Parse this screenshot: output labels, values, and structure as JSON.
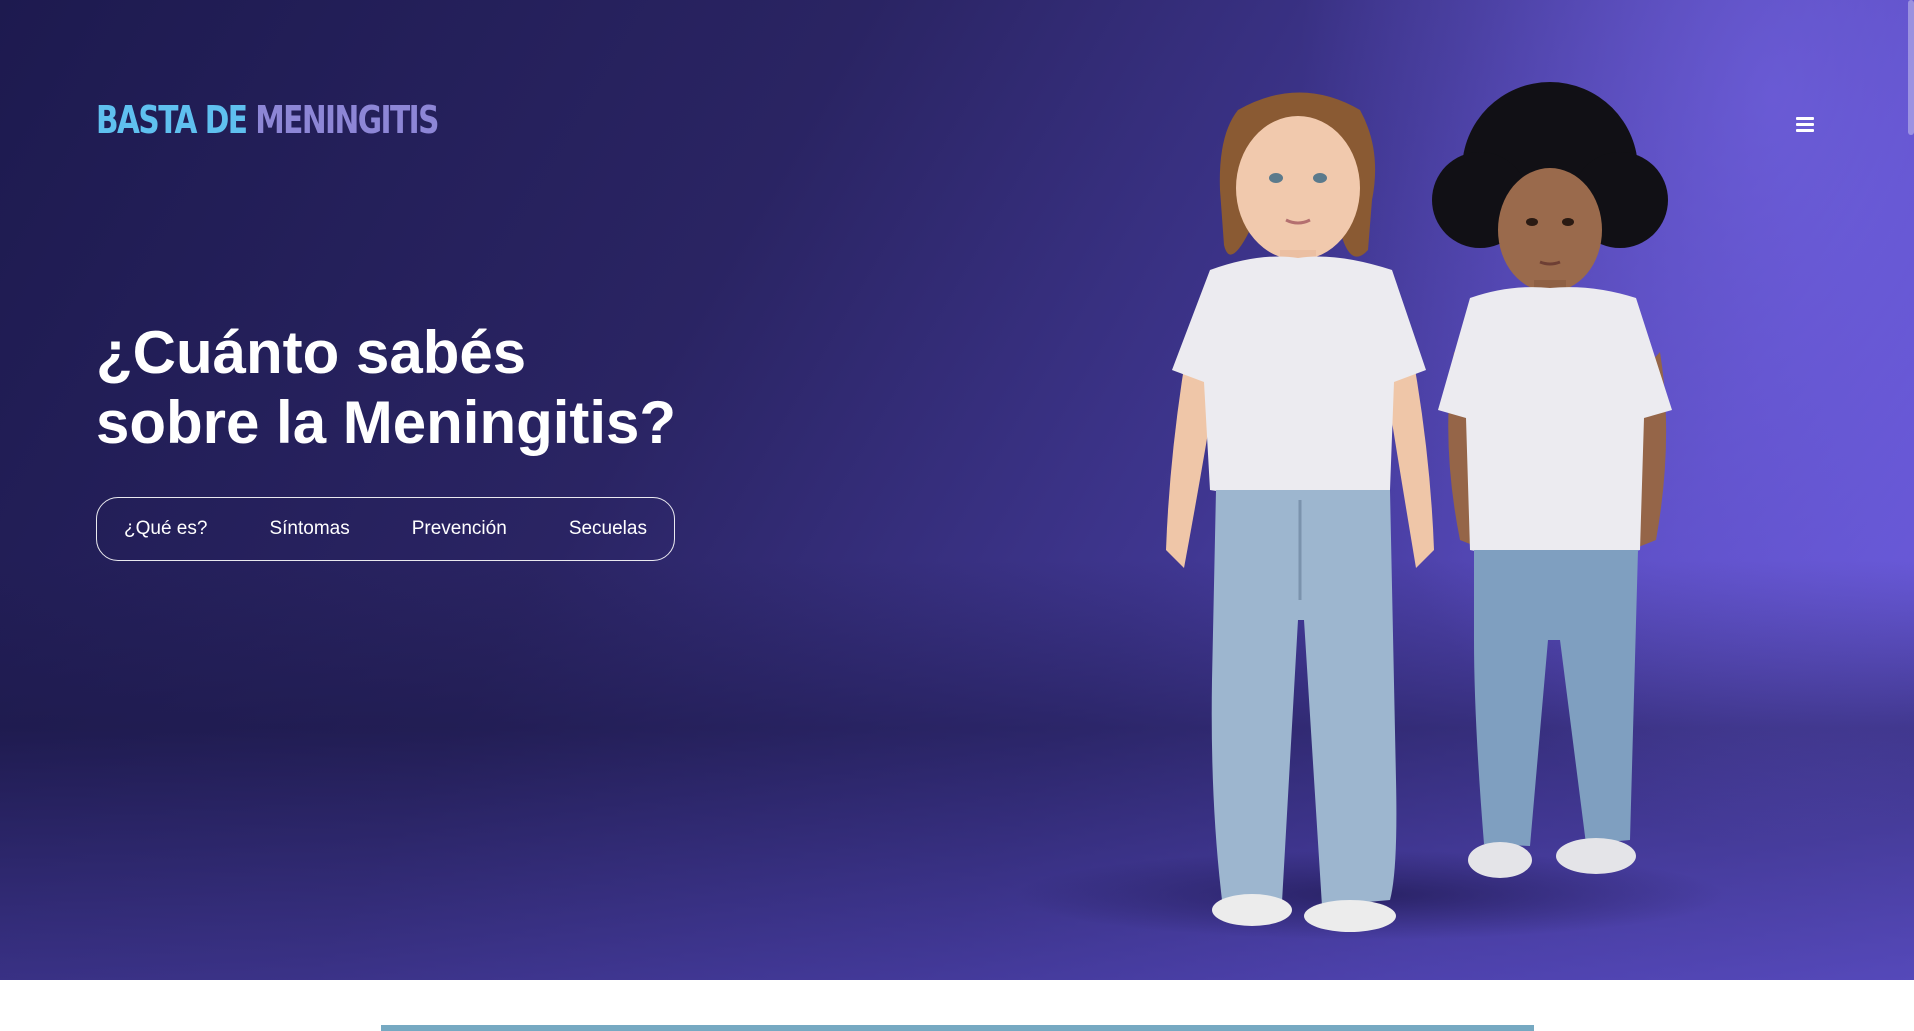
{
  "header": {
    "logo_part1": "BASTA DE ",
    "logo_part2": "MENINGITIS",
    "menu_icon": "hamburger-menu-icon"
  },
  "hero": {
    "headline_line1": "¿Cuánto sabés",
    "headline_line2": "sobre la Meningitis?",
    "nav": [
      {
        "label": "¿Qué es?"
      },
      {
        "label": "Síntomas"
      },
      {
        "label": "Prevención"
      },
      {
        "label": "Secuelas"
      }
    ],
    "image": "two-children-photo"
  },
  "colors": {
    "hero_gradient_start": "#1d1a4f",
    "hero_gradient_end": "#6c5ce0",
    "logo_primary": "#5fc0ef",
    "logo_secondary": "#8d86d6",
    "accent_bar": "#76a9c2"
  }
}
